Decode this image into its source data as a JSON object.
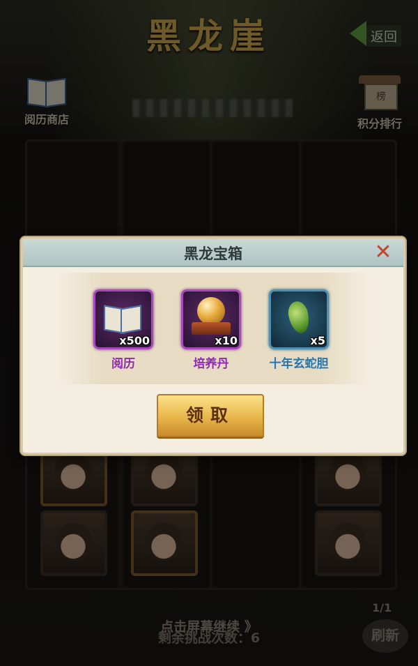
{
  "header": {
    "title": "黑龙崖",
    "back_label": "返回"
  },
  "top_buttons": {
    "shop_label": "阅历商店",
    "rank_label": "积分排行",
    "rank_sign": "榜"
  },
  "modal": {
    "title": "黑龙宝箱",
    "rewards": [
      {
        "name": "阅历",
        "count": "x500",
        "icon": "book-icon",
        "rarity_color": "#a54ab8"
      },
      {
        "name": "培养丹",
        "count": "x10",
        "icon": "pearl-icon",
        "rarity_color": "#a54ab8"
      },
      {
        "name": "十年玄蛇胆",
        "count": "x5",
        "icon": "snake-gall-icon",
        "rarity_color": "#4f8fb2"
      }
    ],
    "claim_label": "领取"
  },
  "footer": {
    "continue_text": "点击屏幕继续 》",
    "challenges_text": "剩余挑战次数：6",
    "page_indicator": "1/1",
    "refresh_label": "刷新"
  },
  "colors": {
    "accent_gold": "#c9a24c",
    "claim_button": "#e8b64a",
    "close_red": "#c4452a"
  }
}
